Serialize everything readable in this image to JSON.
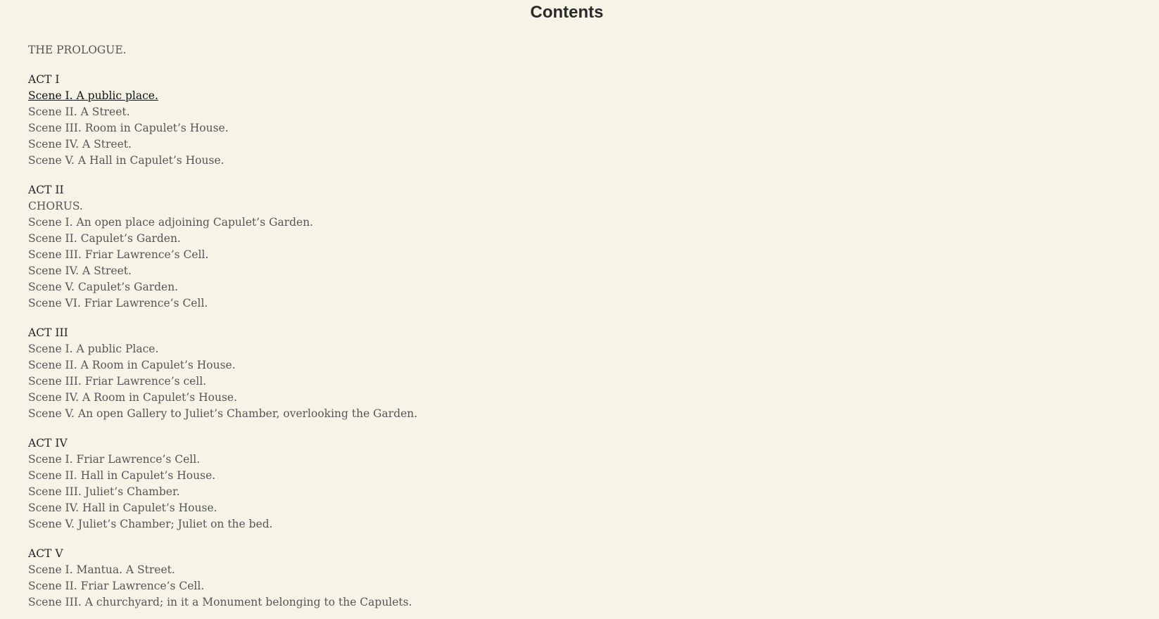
{
  "title": "Contents",
  "prologue": "THE PROLOGUE.",
  "acts": [
    {
      "heading": "ACT I",
      "items": [
        "Scene I. A public place.",
        "Scene II. A Street.",
        "Scene III. Room in Capulet’s House.",
        "Scene IV. A Street.",
        "Scene V. A Hall in Capulet’s House."
      ]
    },
    {
      "heading": "ACT II",
      "items": [
        "CHORUS.",
        "Scene I. An open place adjoining Capulet’s Garden.",
        "Scene II. Capulet’s Garden.",
        "Scene III. Friar Lawrence’s Cell.",
        "Scene IV. A Street.",
        "Scene V. Capulet’s Garden.",
        "Scene VI. Friar Lawrence’s Cell."
      ]
    },
    {
      "heading": "ACT III",
      "items": [
        "Scene I. A public Place.",
        "Scene II. A Room in Capulet’s House.",
        "Scene III. Friar Lawrence’s cell.",
        "Scene IV. A Room in Capulet’s House.",
        "Scene V. An open Gallery to Juliet’s Chamber, overlooking the Garden."
      ]
    },
    {
      "heading": "ACT IV",
      "items": [
        "Scene I. Friar Lawrence’s Cell.",
        "Scene II. Hall in Capulet’s House.",
        "Scene III. Juliet’s Chamber.",
        "Scene IV. Hall in Capulet’s House.",
        "Scene V. Juliet’s Chamber; Juliet on the bed."
      ]
    },
    {
      "heading": "ACT V",
      "items": [
        "Scene I. Mantua. A Street.",
        "Scene II. Friar Lawrence’s Cell.",
        "Scene III. A churchyard; in it a Monument belonging to the Capulets."
      ]
    }
  ]
}
